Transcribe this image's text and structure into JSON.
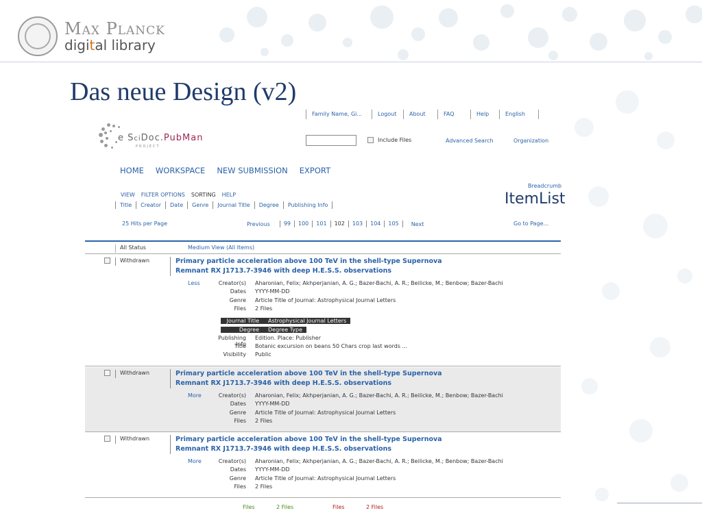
{
  "slide": {
    "brand_top": "Max Planck",
    "brand_bottom_prefix": "digi",
    "brand_bottom_accent": "t",
    "brand_bottom_suffix": "al library",
    "title": "Das neue Design (v2)"
  },
  "mockup": {
    "top_nav": [
      "Family Name, Gi...",
      "Logout",
      "About",
      "FAQ",
      "Help",
      "English"
    ],
    "brand": {
      "prefix": "e S",
      "sci": "ci",
      "doc": "Doc.",
      "pub": "PubMan",
      "sub": "PROJECT"
    },
    "search": {
      "value": "",
      "include_files_label": "Include Files",
      "advanced_label": "Advanced Search",
      "org_label": "Organization"
    },
    "main_nav": [
      "HOME",
      "WORKSPACE",
      "NEW SUBMISSION",
      "EXPORT"
    ],
    "view_nav": [
      "VIEW",
      "FILTER OPTIONS",
      "SORTING",
      "HELP"
    ],
    "sort_nav": [
      "Title",
      "Creator",
      "Date",
      "Genre",
      "Journal Title",
      "Degree",
      "Publishing Info"
    ],
    "breadcrumb": "Breadcrumb",
    "page_heading": "ItemList",
    "hits_per_page": "25 Hits per Page",
    "pager": {
      "prev": "Previous",
      "pages": [
        "99",
        "100",
        "101",
        "102",
        "103",
        "104",
        "105"
      ],
      "current": "102",
      "next": "Next"
    },
    "goto": "Go to Page...",
    "list_head": {
      "status": "All Status",
      "view": "Medium View (All Items)"
    },
    "items": [
      {
        "status": "Withdrawn",
        "title_line1": "Primary particle acceleration above 100 TeV in the shell-type Supernova",
        "title_line2": "Remnant RX J1713.7-3946 with deep H.E.S.S. observations",
        "toggle": "Less",
        "meta": [
          {
            "k": "Creator(s)",
            "v": "Aharonian, Felix; Akhperjanian, A. G.; Bazer-Bachi, A. R.; Beilicke, M.; Benbow; Bazer-Bachi"
          },
          {
            "k": "Dates",
            "v": "YYYY-MM-DD"
          },
          {
            "k": "Genre",
            "v": "Article Title of Journal: Astrophysical Journal Letters"
          },
          {
            "k": "Files",
            "v": "2 Files"
          }
        ],
        "extra": [
          {
            "k": "Journal Title",
            "v": "Astrophysical Journal Letters",
            "hl": true
          },
          {
            "k": "Degree",
            "v": "Degree Type",
            "hl": true
          },
          {
            "k": "Publishing Info",
            "v": "Edition. Place: Publisher",
            "hl": false
          },
          {
            "k": "Title",
            "v": "Botanic excursion on beans 50 Chars crop last words ...",
            "hl": false
          },
          {
            "k": "Visibility",
            "v": "Public",
            "hl": false
          }
        ]
      },
      {
        "status": "Withdrawn",
        "title_line1": "Primary particle acceleration above 100 TeV in the shell-type Supernova",
        "title_line2": "Remnant RX J1713.7-3946 with deep H.E.S.S. observations",
        "toggle": "More",
        "meta": [
          {
            "k": "Creator(s)",
            "v": "Aharonian, Felix; Akhperjanian, A. G.; Bazer-Bachi, A. R.; Beilicke, M.; Benbow; Bazer-Bachi"
          },
          {
            "k": "Dates",
            "v": "YYYY-MM-DD"
          },
          {
            "k": "Genre",
            "v": "Article Title of Journal: Astrophysical Journal Letters"
          },
          {
            "k": "Files",
            "v": "2 Files"
          }
        ]
      },
      {
        "status": "Withdrawn",
        "title_line1": "Primary particle acceleration above 100 TeV in the shell-type Supernova",
        "title_line2": "Remnant RX J1713.7-3946 with deep H.E.S.S. observations",
        "toggle": "More",
        "meta": [
          {
            "k": "Creator(s)",
            "v": "Aharonian, Felix; Akhperjanian, A. G.; Bazer-Bachi, A. R.; Beilicke, M.; Benbow; Bazer-Bachi"
          },
          {
            "k": "Dates",
            "v": "YYYY-MM-DD"
          },
          {
            "k": "Genre",
            "v": "Article Title of Journal: Astrophysical Journal Letters"
          },
          {
            "k": "Files",
            "v": "2 Files"
          }
        ]
      }
    ],
    "footer_files": [
      {
        "k": "Files",
        "v": "2 Files",
        "color": "#4a8a1c"
      },
      {
        "k": "Files",
        "v": "2 Files",
        "color": "#b01e1e"
      }
    ]
  },
  "colors": {
    "link": "#2a62a8",
    "title": "#1f3b6a",
    "accent_orange": "#d0741c",
    "highlight_bg": "#333333",
    "row_shade": "#eaeaea"
  }
}
